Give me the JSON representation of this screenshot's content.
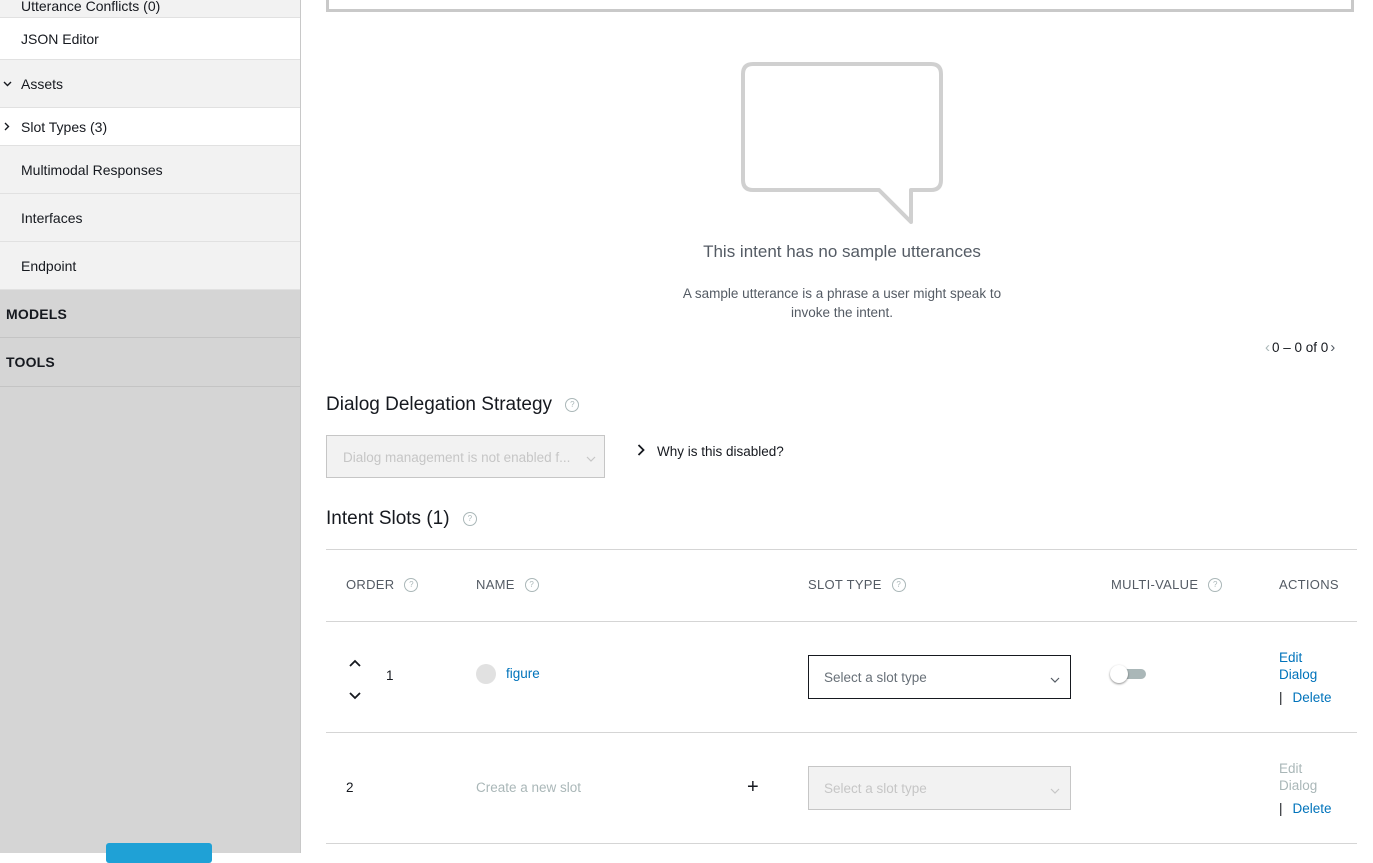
{
  "sidebar": {
    "items": [
      {
        "label": "Utterance Conflicts (0)"
      },
      {
        "label": "JSON Editor"
      },
      {
        "label": "Assets"
      },
      {
        "label": "Slot Types (3)"
      },
      {
        "label": "Multimodal Responses"
      },
      {
        "label": "Interfaces"
      },
      {
        "label": "Endpoint"
      }
    ],
    "sections": [
      {
        "label": "MODELS"
      },
      {
        "label": "TOOLS"
      }
    ]
  },
  "empty_state": {
    "title": "This intent has no sample utterances",
    "description": "A sample utterance is a phrase a user might speak to invoke the intent."
  },
  "pager": {
    "text": "0 – 0 of 0"
  },
  "delegation": {
    "title": "Dialog Delegation Strategy",
    "select_value": "Dialog management is not enabled f...",
    "why_link": "Why is this disabled?"
  },
  "slots": {
    "title": "Intent Slots (1)",
    "columns": {
      "order": "ORDER",
      "name": "NAME",
      "slot_type": "SLOT TYPE",
      "multi_value": "MULTI-VALUE",
      "actions": "ACTIONS"
    },
    "rows": [
      {
        "order": "1",
        "name": "figure",
        "slot_type_placeholder": "Select a slot type",
        "edit_dialog": "Edit Dialog",
        "delete": "Delete",
        "multi_value": false
      },
      {
        "order": "2",
        "name_placeholder": "Create a new slot",
        "add_symbol": "+",
        "slot_type_placeholder": "Select a slot type",
        "edit_dialog": "Edit Dialog",
        "delete": "Delete"
      }
    ]
  },
  "colors": {
    "link": "#0073bb",
    "sidebar_bg": "#d5d5d5",
    "feedback_button": "#1fa1d6"
  },
  "icons": {
    "empty_state": "speech-bubble-icon",
    "help": "question-circle-icon"
  }
}
